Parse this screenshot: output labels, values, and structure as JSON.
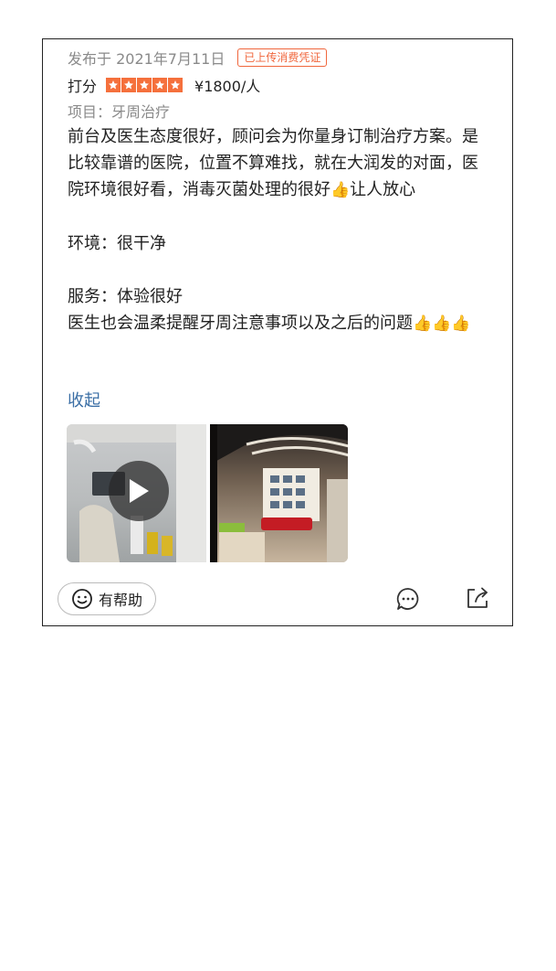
{
  "review": {
    "date": "发布于 2021年7月11日",
    "badge": "已上传消费凭证",
    "rating_label": "打分",
    "stars": 5,
    "price": "¥1800/人",
    "project": "项目：牙周治疗",
    "paragraphs": [
      "前台及医生态度很好，顾问会为你量身订制治疗方案。是比较靠谱的医院，位置不算难找，就在大润发的对面，医院环境很好看，消毒灭菌处理的很好",
      "👍",
      "让人放心",
      "环境：很干净",
      "服务：体验很好",
      "医生也会温柔提醒牙周注意事项以及之后的问题",
      "👍👍👍"
    ],
    "collapse_label": "收起"
  },
  "actions": {
    "helpful_label": "有帮助"
  },
  "icons": {
    "star": "star-icon",
    "play": "play-icon",
    "smile": "smile-icon",
    "comment": "comment-icon",
    "share": "share-icon"
  },
  "colors": {
    "accent": "#f0663c",
    "star": "#f5703c",
    "link": "#3a6ea5",
    "muted": "#8a8a8a"
  }
}
